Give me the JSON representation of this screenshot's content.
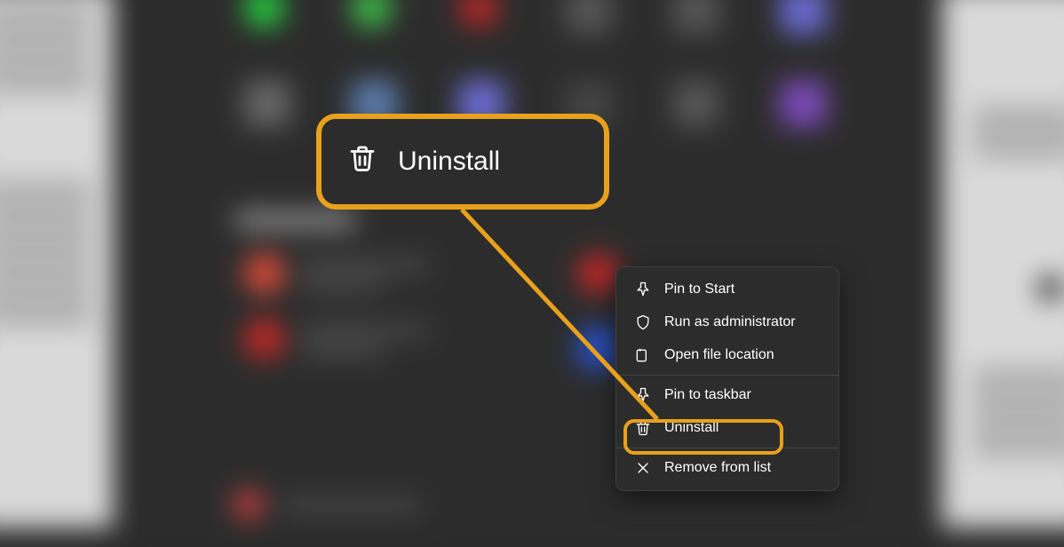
{
  "callout": {
    "label": "Uninstall"
  },
  "contextMenu": {
    "items": [
      {
        "label": "Pin to Start",
        "icon": "pin-icon"
      },
      {
        "label": "Run as administrator",
        "icon": "shield-icon"
      },
      {
        "label": "Open file location",
        "icon": "folder-icon"
      },
      {
        "label": "Pin to taskbar",
        "icon": "pin-icon"
      },
      {
        "label": "Uninstall",
        "icon": "trash-icon",
        "highlighted": true
      },
      {
        "label": "Remove from list",
        "icon": "close-icon"
      }
    ],
    "separatorsAfterIndex": [
      2,
      4
    ]
  },
  "annotation": {
    "highlightColor": "#e8a11c"
  }
}
